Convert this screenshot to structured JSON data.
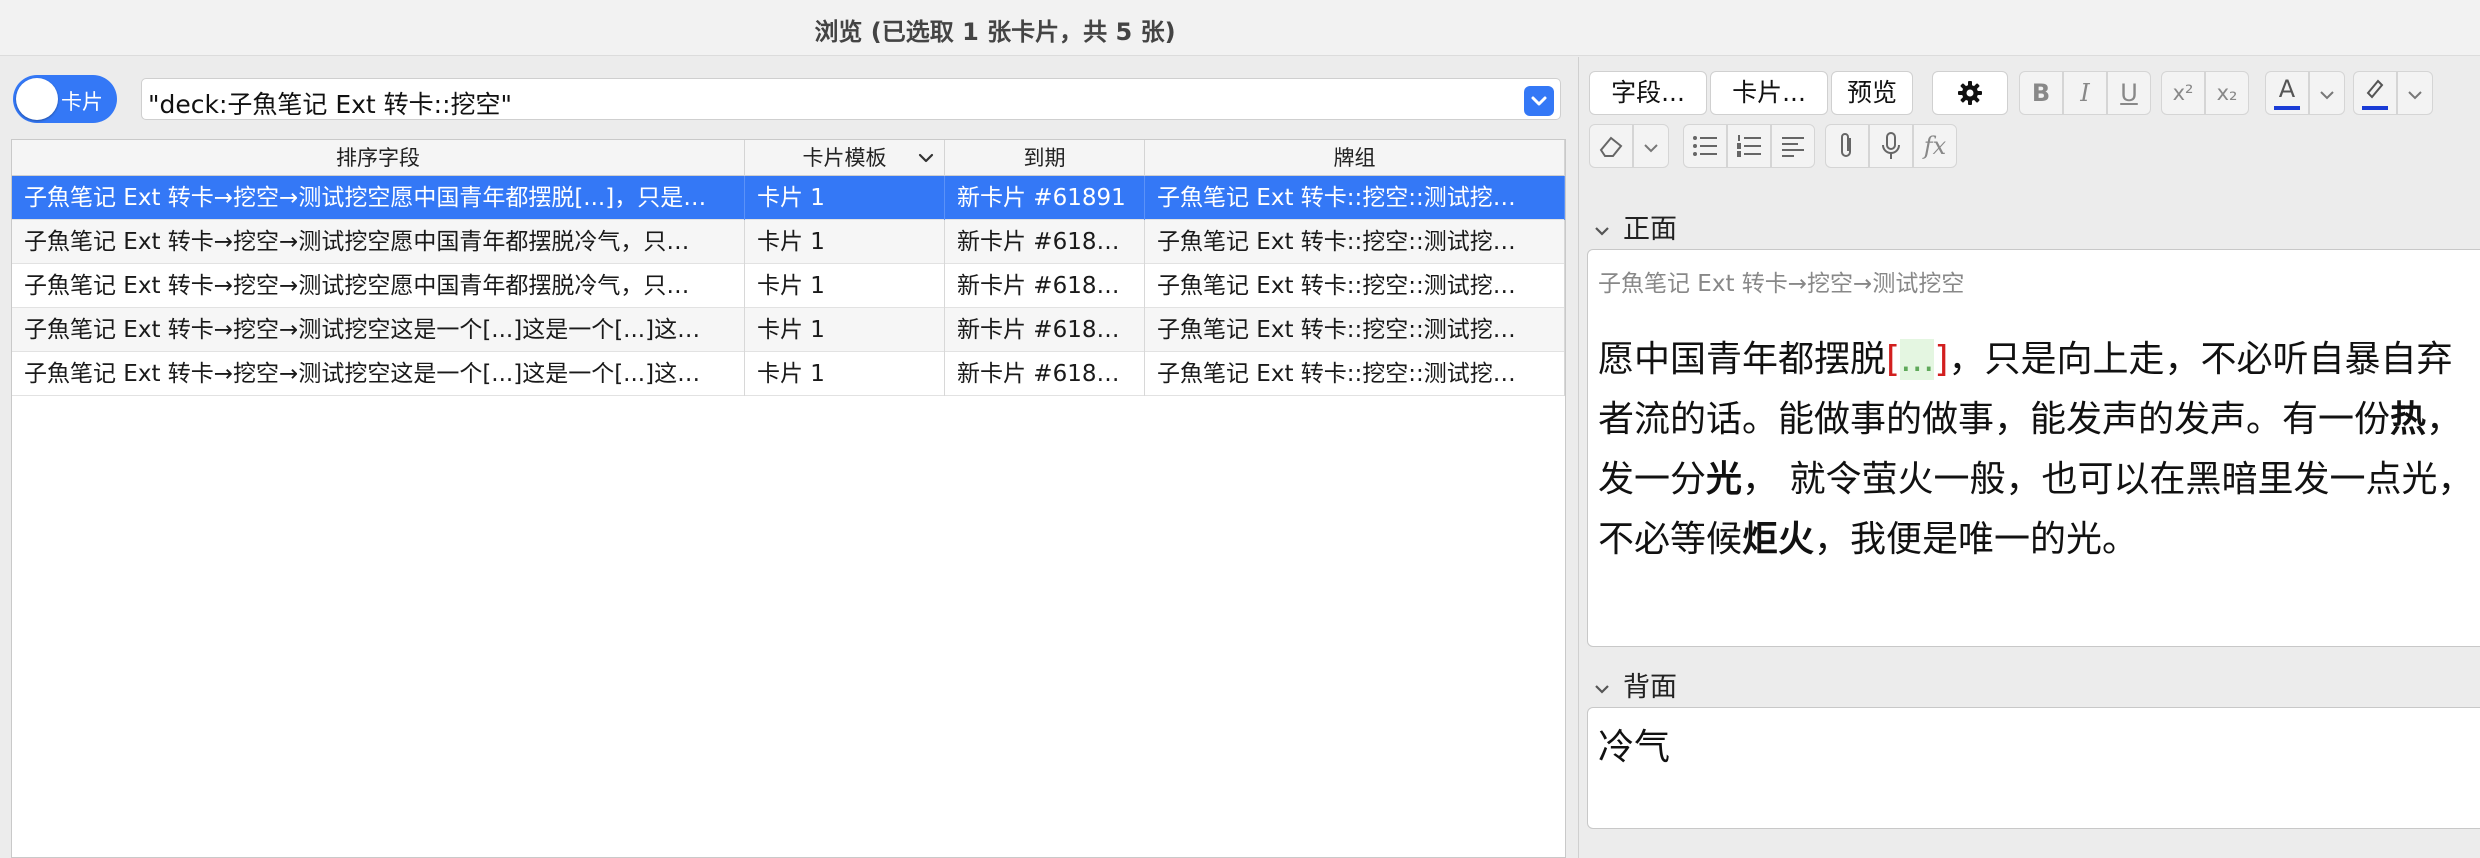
{
  "window": {
    "title": "浏览 (已选取 1 张卡片，共 5 张)"
  },
  "toggle": {
    "label": "卡片",
    "on": true
  },
  "search": {
    "value": "\"deck:子魚笔记 Ext 转卡::挖空\""
  },
  "table": {
    "columns": [
      "排序字段",
      "卡片模板",
      "到期",
      "牌组"
    ],
    "rows": [
      {
        "sort": "子魚笔记 Ext 转卡→挖空→测试挖空愿中国青年都摆脱[...]，只是…",
        "template": "卡片 1",
        "due": "新卡片 #61891",
        "deck": "子魚笔记 Ext 转卡::挖空::测试挖…",
        "selected": true
      },
      {
        "sort": "子魚笔记 Ext 转卡→挖空→测试挖空愿中国青年都摆脱冷气，只…",
        "template": "卡片 1",
        "due": "新卡片 #618…",
        "deck": "子魚笔记 Ext 转卡::挖空::测试挖…",
        "selected": false
      },
      {
        "sort": "子魚笔记 Ext 转卡→挖空→测试挖空愿中国青年都摆脱冷气，只…",
        "template": "卡片 1",
        "due": "新卡片 #618…",
        "deck": "子魚笔记 Ext 转卡::挖空::测试挖…",
        "selected": false
      },
      {
        "sort": "子魚笔记 Ext 转卡→挖空→测试挖空这是一个[...]这是一个[...]这…",
        "template": "卡片 1",
        "due": "新卡片 #618…",
        "deck": "子魚笔记 Ext 转卡::挖空::测试挖…",
        "selected": false
      },
      {
        "sort": "子魚笔记 Ext 转卡→挖空→测试挖空这是一个[...]这是一个[...]这…",
        "template": "卡片 1",
        "due": "新卡片 #618…",
        "deck": "子魚笔记 Ext 转卡::挖空::测试挖…",
        "selected": false
      }
    ]
  },
  "editor": {
    "toolbar": {
      "fields_label": "字段...",
      "cards_label": "卡片...",
      "preview_label": "预览"
    },
    "icons": {
      "gear": "gear-icon",
      "bold": "B",
      "italic": "I",
      "underline": "U",
      "superscript": "x²",
      "subscript": "x₂",
      "text_color": "A",
      "eraser": "eraser-icon",
      "unordered_list": "list-icon",
      "ordered_list": "ordered-list-icon",
      "align": "align-icon",
      "attach": "paperclip-icon",
      "record": "mic-icon",
      "math": "fx"
    },
    "colors": {
      "accent": "#3478f6",
      "cloze_bracket": "#d21f1f",
      "cloze_fill": "#5fa95a",
      "text_color_bar": "#1a3cd6"
    },
    "front": {
      "label": "正面",
      "source": "子魚笔记 Ext 转卡→挖空→测试挖空",
      "text_1": "愿中国青年都摆脱",
      "cloze_open": "[",
      "cloze_dots": "...",
      "cloze_close": "]",
      "text_2": "，只是向上走，不必听自暴自弃者流的话。能做事的做事，能发声的发声。有一份",
      "bold_1": "热",
      "text_3": "，发一分",
      "bold_2": "光",
      "text_4": "， 就令萤火一般，也可以在黑暗里发一点光，不必等候",
      "bold_3": "炬火",
      "text_5": "，我便是唯一的光。"
    },
    "back": {
      "label": "背面",
      "text": "冷气"
    }
  }
}
